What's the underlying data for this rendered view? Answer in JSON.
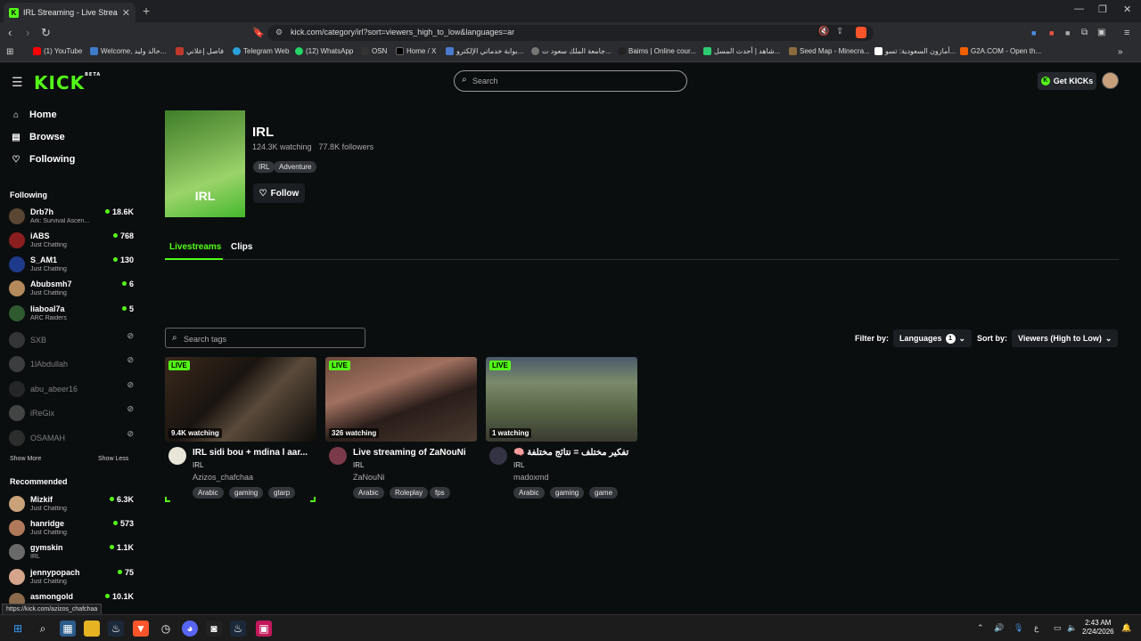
{
  "browser": {
    "tab_title": "IRL Streaming - Live Streams",
    "url": "kick.com/category/irl?sort=viewers_high_to_low&languages=ar",
    "bookmarks": [
      {
        "label": "(1) YouTube",
        "color": "#ff0000"
      },
      {
        "label": "Welcome, خالد وليد...",
        "color": "#3d7cc9"
      },
      {
        "label": "فاصل إعلاني",
        "color": "#c0392b"
      },
      {
        "label": "Telegram Web",
        "color": "#2aa1da"
      },
      {
        "label": "(12) WhatsApp",
        "color": "#25d366"
      },
      {
        "label": "OSN",
        "color": "#333"
      },
      {
        "label": "Home / X",
        "color": "#000"
      },
      {
        "label": "بوابة خدماتي الإلكترو...",
        "color": "#4a7bd0"
      },
      {
        "label": "جامعة الملك سعود ت...",
        "color": "#777"
      },
      {
        "label": "Baims | Online cour...",
        "color": "#222"
      },
      {
        "label": "شاهد | أحدث المسل...",
        "color": "#2ecc71"
      },
      {
        "label": "Seed Map - Minecra...",
        "color": "#8b6b3d"
      },
      {
        "label": "أمازون السعودية: تسو...",
        "color": "#fff"
      },
      {
        "label": "G2A.COM - Open th...",
        "color": "#f05f00"
      }
    ]
  },
  "header": {
    "logo": "KICK",
    "logo_badge": "BETA",
    "search_placeholder": "Search",
    "get_kicks": "Get KICKs"
  },
  "sidebar": {
    "nav": [
      {
        "label": "Home",
        "icon": "home-icon"
      },
      {
        "label": "Browse",
        "icon": "browse-icon"
      },
      {
        "label": "Following",
        "icon": "heart-icon"
      }
    ],
    "following_title": "Following",
    "following": [
      {
        "name": "Drb7h",
        "category": "Ark: Survival Ascen...",
        "viewers": "18.6K",
        "color": "#5a4632"
      },
      {
        "name": "iABS",
        "category": "Just Chatting",
        "viewers": "768",
        "color": "#8a1e1e"
      },
      {
        "name": "S_AM1",
        "category": "Just Chatting",
        "viewers": "130",
        "color": "#1e3a8a"
      },
      {
        "name": "Abubsmh7",
        "category": "Just Chatting",
        "viewers": "6",
        "color": "#b58a5a"
      },
      {
        "name": "liaboal7a",
        "category": "ARC Raiders",
        "viewers": "5",
        "color": "#2f5a2f"
      }
    ],
    "offline": [
      {
        "name": "SXB",
        "color": "#666"
      },
      {
        "name": "1lAbdullah",
        "color": "#777"
      },
      {
        "name": "abu_abeer16",
        "color": "#444"
      },
      {
        "name": "iReGix",
        "color": "#888"
      },
      {
        "name": "OSAMAH",
        "color": "#555"
      }
    ],
    "show_more": "Show More",
    "show_less": "Show Less",
    "recommended_title": "Recommended",
    "recommended": [
      {
        "name": "Mizkif",
        "category": "Just Chatting",
        "viewers": "6.3K",
        "color": "#c9a27a"
      },
      {
        "name": "hanridge",
        "category": "Just Chatting",
        "viewers": "573",
        "color": "#b07a5a"
      },
      {
        "name": "gymskin",
        "category": "IRL",
        "viewers": "1.1K",
        "color": "#6a6a6a"
      },
      {
        "name": "jennypopach",
        "category": "Just Chatting",
        "viewers": "75",
        "color": "#d4a58a"
      },
      {
        "name": "asmongold",
        "category": "",
        "viewers": "10.1K",
        "color": "#8a6a4a"
      }
    ]
  },
  "category": {
    "name": "IRL",
    "image_label": "IRL",
    "watching": "124.3K watching",
    "followers": "77.8K followers",
    "tags": [
      "IRL",
      "Adventure"
    ],
    "follow": "Follow"
  },
  "tabs": [
    "Livestreams",
    "Clips"
  ],
  "filters": {
    "search_tags_placeholder": "Search tags",
    "filter_by": "Filter by:",
    "languages": "Languages",
    "languages_count": "1",
    "sort_by": "Sort by:",
    "sort_value": "Viewers (High to Low)"
  },
  "streams": [
    {
      "live": "LIVE",
      "watching": "9.4K watching",
      "title": "IRL sidi bou + mdina l aar...",
      "category": "IRL",
      "user": "Azizos_chafchaa",
      "tags": [
        "Arabic",
        "gaming",
        "gtarp"
      ]
    },
    {
      "live": "LIVE",
      "watching": "326 watching",
      "title": "Live streaming of ZaNouNi",
      "category": "IRL",
      "user": "ZaNouNi",
      "tags": [
        "Arabic",
        "Roleplay",
        "fps"
      ]
    },
    {
      "live": "LIVE",
      "watching": "1 watching",
      "title": "🧠 تفكير مختلف = نتائج مختلفة",
      "category": "IRL",
      "user": "madoxmd",
      "tags": [
        "Arabic",
        "gaming",
        "game"
      ]
    }
  ],
  "status_url": "https://kick.com/azizos_chafchaa",
  "clock": {
    "time": "2:43 AM",
    "date": "2/24/2026"
  }
}
